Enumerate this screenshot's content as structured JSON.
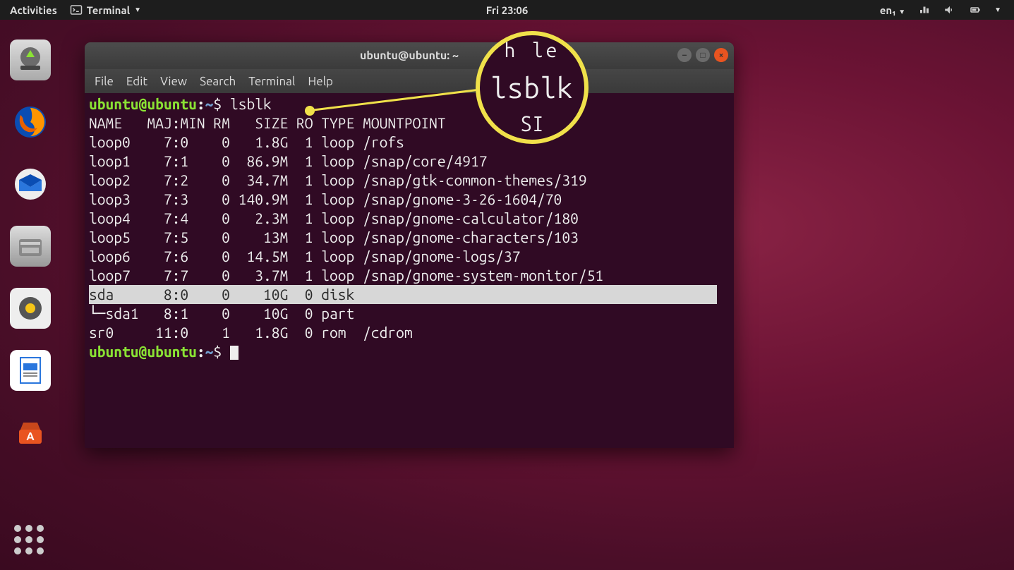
{
  "topbar": {
    "activities": "Activities",
    "app_name": "Terminal",
    "clock": "Fri 23:06",
    "lang": "en₁"
  },
  "window": {
    "title": "ubuntu@ubuntu: ~"
  },
  "menubar": {
    "file": "File",
    "edit": "Edit",
    "view": "View",
    "search": "Search",
    "terminal": "Terminal",
    "help": "Help"
  },
  "prompt": {
    "user_host": "ubuntu@ubuntu",
    "sep": ":",
    "path": "~",
    "sigil": "$"
  },
  "command": "lsblk",
  "header": "NAME   MAJ:MIN RM   SIZE RO TYPE MOUNTPOINT",
  "rows": [
    "loop0    7:0    0   1.8G  1 loop /rofs",
    "loop1    7:1    0  86.9M  1 loop /snap/core/4917",
    "loop2    7:2    0  34.7M  1 loop /snap/gtk-common-themes/319",
    "loop3    7:3    0 140.9M  1 loop /snap/gnome-3-26-1604/70",
    "loop4    7:4    0   2.3M  1 loop /snap/gnome-calculator/180",
    "loop5    7:5    0    13M  1 loop /snap/gnome-characters/103",
    "loop6    7:6    0  14.5M  1 loop /snap/gnome-logs/37",
    "loop7    7:7    0   3.7M  1 loop /snap/gnome-system-monitor/51"
  ],
  "highlight_row": "sda      8:0    0    10G  0 disk ",
  "rows_after": [
    "└─sda1   8:1    0    10G  0 part ",
    "sr0     11:0    1   1.8G  0 rom  /cdrom"
  ],
  "magnifier": {
    "top": "h  le",
    "main": "lsblk",
    "bot": "SI"
  }
}
